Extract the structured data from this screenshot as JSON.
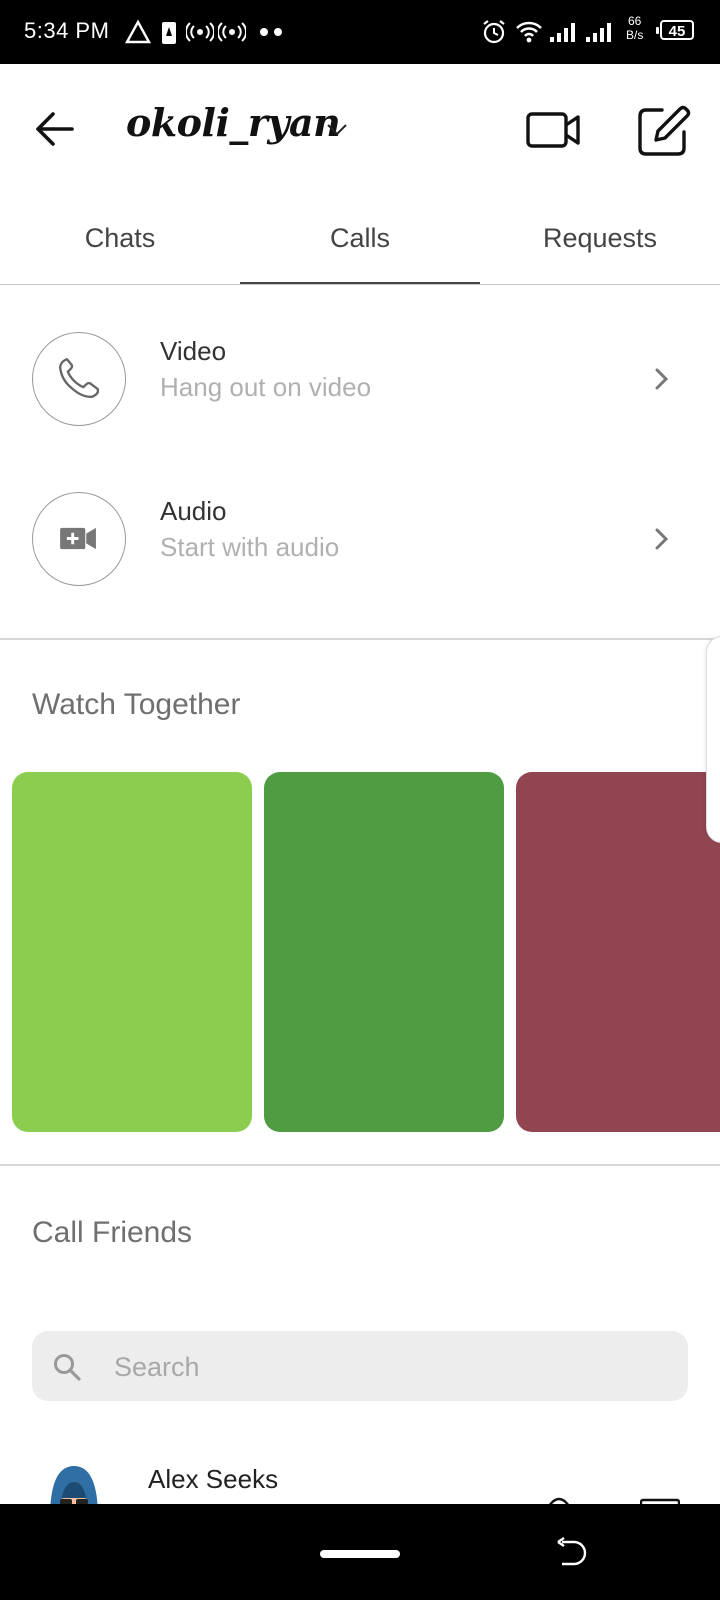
{
  "status_bar": {
    "time": "5:34 PM",
    "speed_value": "66",
    "speed_unit": "B/s",
    "battery": "45"
  },
  "header": {
    "account_name": "okoli_ryan"
  },
  "tabs": [
    {
      "label": "Chats"
    },
    {
      "label": "Calls",
      "selected": true
    },
    {
      "label": "Requests"
    }
  ],
  "call_options": [
    {
      "title": "Video",
      "subtitle": "Hang out on video",
      "icon": "phone-icon"
    },
    {
      "title": "Audio",
      "subtitle": "Start with audio",
      "icon": "video-camera-plus-icon"
    }
  ],
  "watch_together": {
    "title": "Watch Together",
    "card_colors": [
      "#8bcd4e",
      "#4f9c43",
      "#904551"
    ]
  },
  "call_friends": {
    "title": "Call Friends",
    "search_placeholder": "Search"
  },
  "friends": [
    {
      "name": "Alex Seeks"
    }
  ]
}
